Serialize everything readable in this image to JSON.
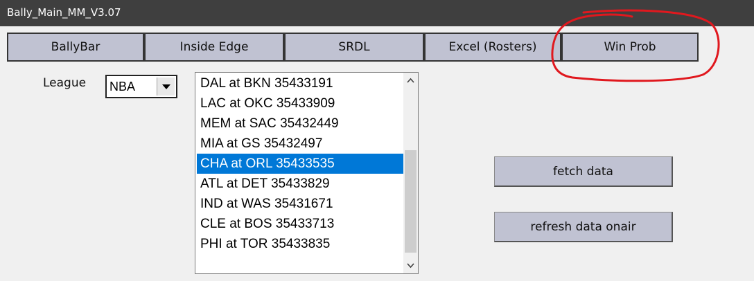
{
  "window": {
    "title": "Bally_Main_MM_V3.07"
  },
  "tabs": [
    {
      "label": "BallyBar"
    },
    {
      "label": "Inside Edge"
    },
    {
      "label": "SRDL"
    },
    {
      "label": "Excel (Rosters)"
    },
    {
      "label": "Win Prob"
    }
  ],
  "league": {
    "label": "League",
    "selected": "NBA"
  },
  "games": {
    "items": [
      "DAL at BKN 35433191",
      "LAC at OKC 35433909",
      "MEM at SAC 35432449",
      "MIA at GS 35432497",
      "CHA at ORL 35433535",
      "ATL at DET 35433829",
      "IND at WAS 35431671",
      "CLE at BOS 35433713",
      "PHI at TOR 35433835"
    ],
    "selected": "CHA at ORL 35433535"
  },
  "actions": {
    "fetch_label": "fetch data",
    "refresh_label": "refresh data onair"
  },
  "colors": {
    "titlebar": "#3f3f3f",
    "button_bg": "#c0c2d2",
    "selection": "#0078d7",
    "annotation": "#e0181e"
  },
  "icons": {
    "dropdown": "chevron-down-icon",
    "scroll_up": "chevron-up-icon",
    "scroll_down": "chevron-down-icon"
  }
}
